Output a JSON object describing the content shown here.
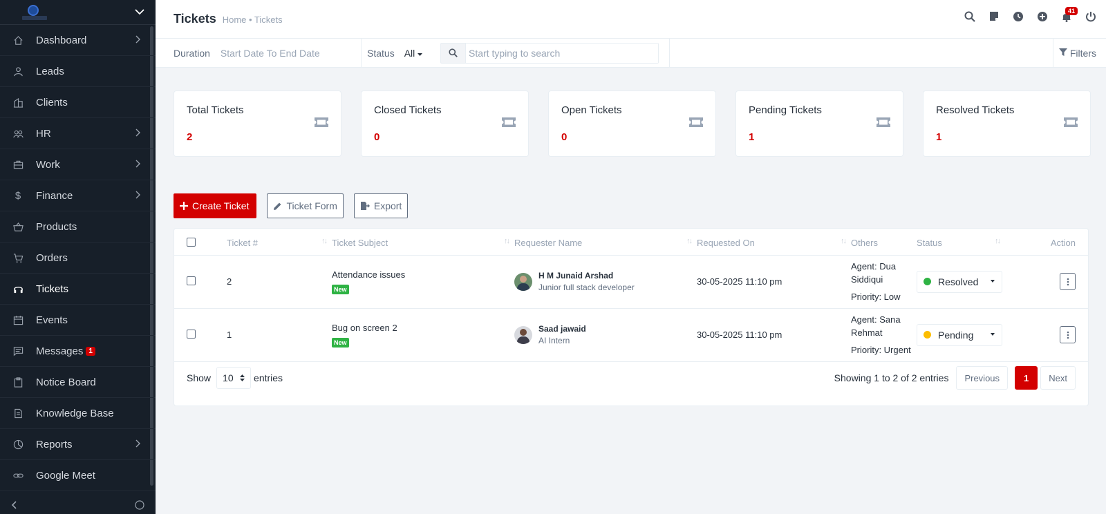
{
  "sidebar": {
    "items": [
      {
        "label": "Dashboard",
        "icon": "house-icon",
        "has_arrow": true
      },
      {
        "label": "Leads",
        "icon": "user-icon",
        "has_arrow": false
      },
      {
        "label": "Clients",
        "icon": "building-icon",
        "has_arrow": false
      },
      {
        "label": "HR",
        "icon": "people-icon",
        "has_arrow": true
      },
      {
        "label": "Work",
        "icon": "briefcase-icon",
        "has_arrow": true
      },
      {
        "label": "Finance",
        "icon": "dollar-icon",
        "has_arrow": true
      },
      {
        "label": "Products",
        "icon": "basket-icon",
        "has_arrow": false
      },
      {
        "label": "Orders",
        "icon": "cart-icon",
        "has_arrow": false
      },
      {
        "label": "Tickets",
        "icon": "headset-icon",
        "has_arrow": false,
        "active": true
      },
      {
        "label": "Events",
        "icon": "calendar-icon",
        "has_arrow": false
      },
      {
        "label": "Messages",
        "icon": "chat-icon",
        "has_arrow": false,
        "badge": "1"
      },
      {
        "label": "Notice Board",
        "icon": "clipboard-icon",
        "has_arrow": false
      },
      {
        "label": "Knowledge Base",
        "icon": "document-icon",
        "has_arrow": false
      },
      {
        "label": "Reports",
        "icon": "pie-chart-icon",
        "has_arrow": true
      },
      {
        "label": "Google Meet",
        "icon": "link-icon",
        "has_arrow": false
      }
    ]
  },
  "header": {
    "title": "Tickets",
    "breadcrumb": "Home • Tickets",
    "notification_count": "41"
  },
  "filters": {
    "duration_label": "Duration",
    "duration_value": "Start Date To End Date",
    "status_label": "Status",
    "status_value": "All",
    "search_placeholder": "Start typing to search",
    "filters_label": "Filters"
  },
  "cards": [
    {
      "title": "Total Tickets",
      "value": "2"
    },
    {
      "title": "Closed Tickets",
      "value": "0"
    },
    {
      "title": "Open Tickets",
      "value": "0"
    },
    {
      "title": "Pending Tickets",
      "value": "1"
    },
    {
      "title": "Resolved Tickets",
      "value": "1"
    }
  ],
  "actions": {
    "create": "Create Ticket",
    "form": "Ticket Form",
    "export": "Export"
  },
  "table": {
    "columns": [
      "Ticket #",
      "Ticket Subject",
      "Requester Name",
      "Requested On",
      "Others",
      "Status",
      "Action"
    ],
    "rows": [
      {
        "ticket": "2",
        "subject": "Attendance issues",
        "tag": "New",
        "requester": "H M Junaid Arshad",
        "role": "Junior full stack developer",
        "requested_on": "30-05-2025 11:10 pm",
        "agent_line1": "Agent: Dua",
        "agent_line2": "Siddiqui",
        "priority": "Priority: Low",
        "status": "Resolved",
        "status_color": "#2fb344"
      },
      {
        "ticket": "1",
        "subject": "Bug on screen 2",
        "tag": "New",
        "requester": "Saad jawaid",
        "role": "AI Intern",
        "requested_on": "30-05-2025 11:10 pm",
        "agent_line1": "Agent: Sana",
        "agent_line2": "Rehmat",
        "priority": "Priority: Urgent",
        "status": "Pending",
        "status_color": "#fcbd01"
      }
    ],
    "show_label": "Show",
    "show_value": "10",
    "entries_label": "entries",
    "info": "Showing 1 to 2 of 2 entries",
    "prev": "Previous",
    "page": "1",
    "next": "Next"
  },
  "colors": {
    "accent": "#d30000",
    "sidebar_bg": "#171f29",
    "resolved": "#2fb344",
    "pending": "#fcbd01"
  }
}
